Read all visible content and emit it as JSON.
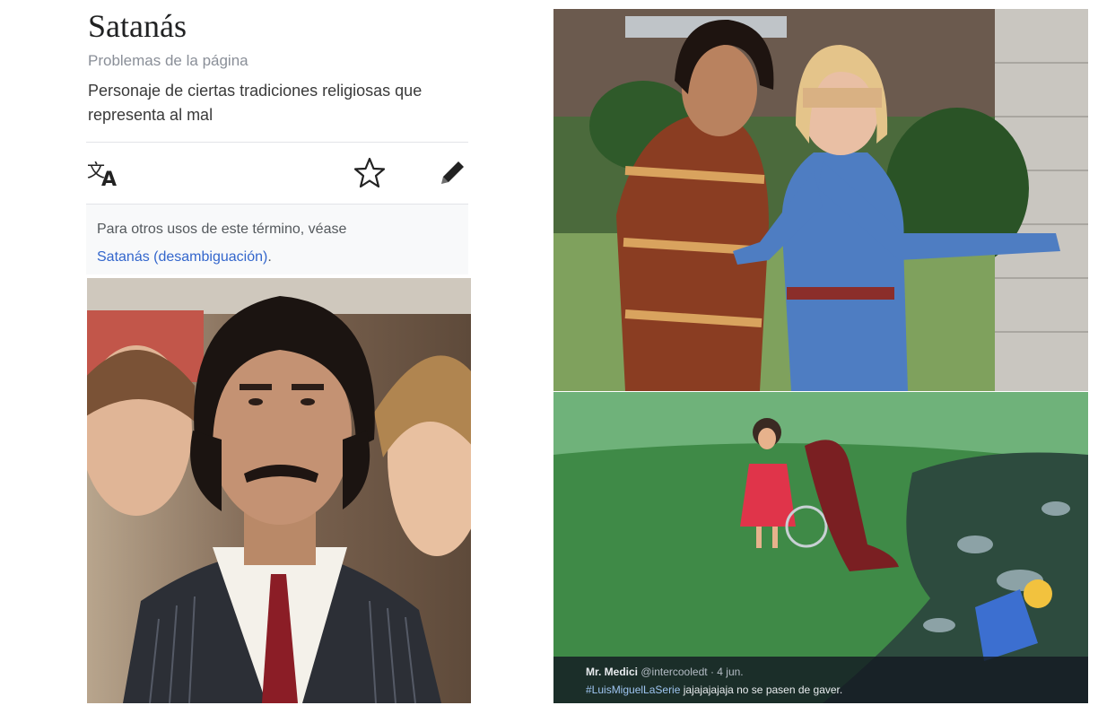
{
  "wiki": {
    "title": "Satanás",
    "issues": "Problemas de la página",
    "description": "Personaje de ciertas tradiciones religiosas que representa al mal",
    "hatnote": {
      "prefix": "Para otros usos de este término, véase",
      "link": "Satanás (desambiguación)",
      "suffix": "."
    },
    "icons": [
      "language-icon",
      "star-icon",
      "pencil-icon"
    ]
  },
  "tweet": {
    "name": "Mr. Medici",
    "handle": "@intercooledt",
    "date": "· 4 jun.",
    "hashtag": "#LuisMiguelLaSerie",
    "text": "jajajajajaja no se pasen de gaver."
  },
  "colors": {
    "link": "#3366cc",
    "hatnote_bg": "#f8f9fa",
    "tweet_bar": "#141a22",
    "lawn": "#3f8a47"
  }
}
